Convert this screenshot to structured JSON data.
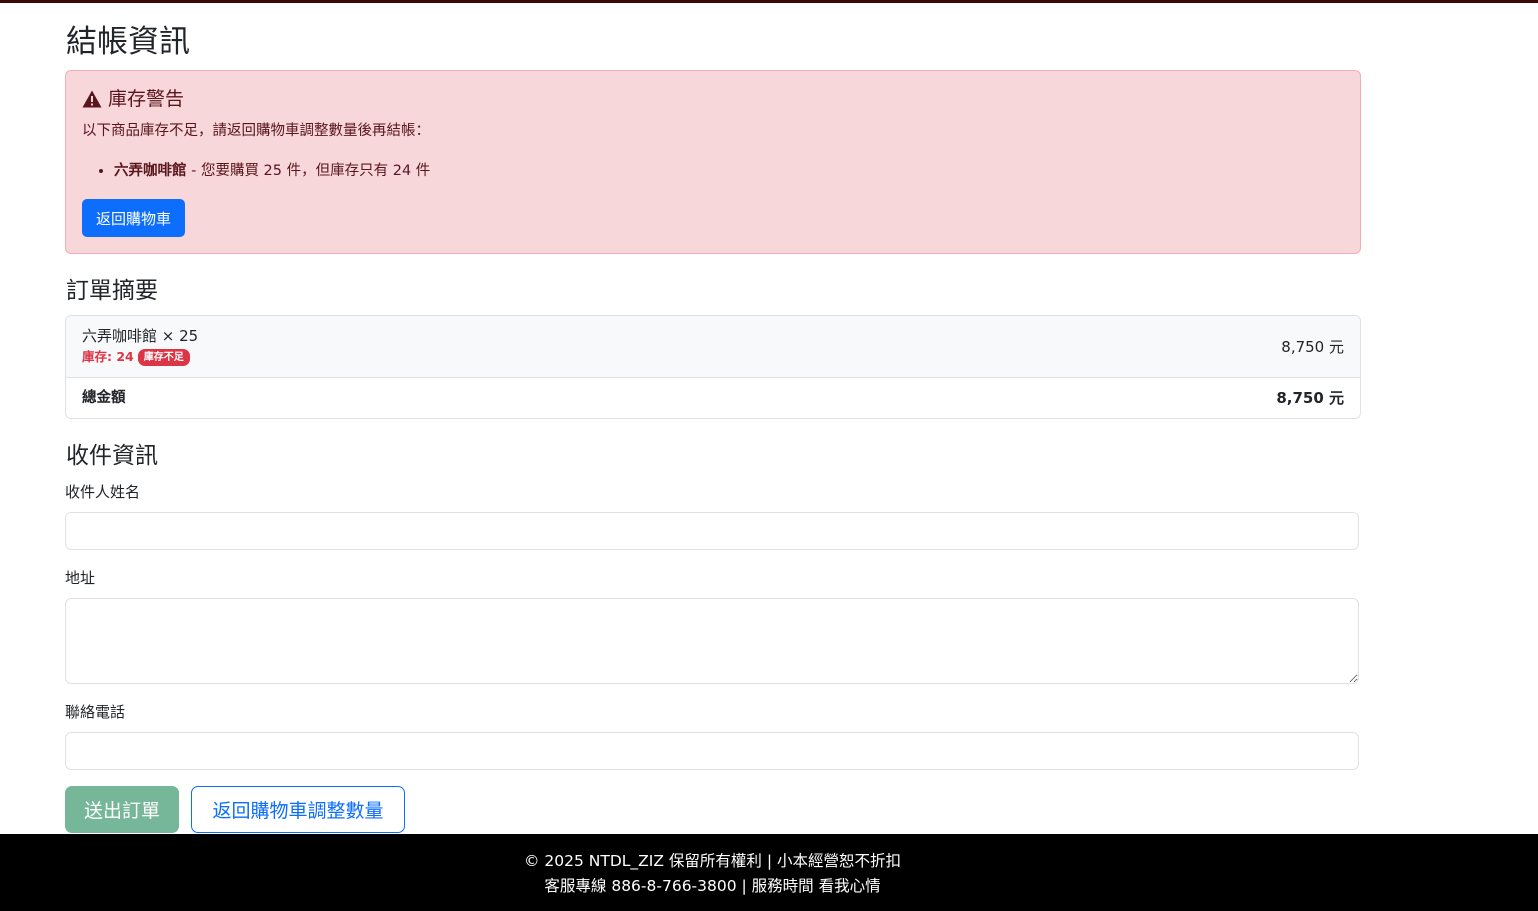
{
  "page": {
    "title": "結帳資訊"
  },
  "alert": {
    "heading": "庫存警告",
    "text": "以下商品庫存不足，請返回購物車調整數量後再結帳：",
    "items": [
      {
        "name": "六弄咖啡館",
        "detail": " - 您要購買 25 件，但庫存只有 24 件"
      }
    ],
    "button_label": "返回購物車",
    "colors": {
      "background": "#f8d7da",
      "border": "#f1aeb5",
      "text": "#58151c"
    }
  },
  "summary": {
    "title": "訂單摘要",
    "items": [
      {
        "name": "六弄咖啡館 × 25",
        "stock_text": "庫存: 24",
        "badge": "庫存不足",
        "price": "8,750 元"
      }
    ],
    "total_label": "總金額",
    "total_value": "8,750 元"
  },
  "shipping": {
    "title": "收件資訊",
    "name_label": "收件人姓名",
    "name_value": "",
    "address_label": "地址",
    "address_value": "",
    "phone_label": "聯絡電話",
    "phone_value": ""
  },
  "actions": {
    "submit_label": "送出訂單",
    "back_label": "返回購物車調整數量"
  },
  "footer": {
    "line1": "© 2025 NTDL_ZIZ 保留所有權利 | 小本經營恕不折扣",
    "line2": "客服專線 886-8-766-3800 | 服務時間 看我心情"
  },
  "colors": {
    "primary": "#0d6efd",
    "success_disabled": "#75b798",
    "danger": "#dc3545",
    "footer_bg": "#000000"
  },
  "icons": {
    "alert_icon": "warning-triangle-icon"
  }
}
